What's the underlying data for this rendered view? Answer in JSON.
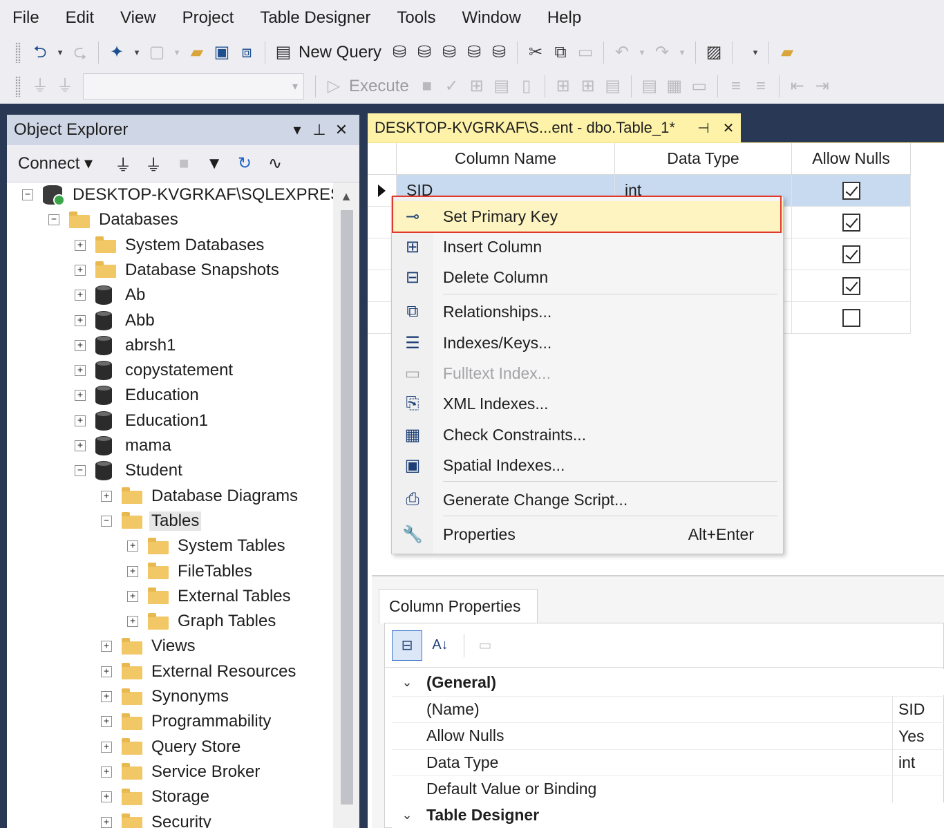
{
  "menu": [
    "File",
    "Edit",
    "View",
    "Project",
    "Table Designer",
    "Tools",
    "Window",
    "Help"
  ],
  "toolbar": {
    "new_query_label": "New Query",
    "execute_label": "Execute",
    "mdx": "MDX",
    "dmx": "DMX",
    "xmla": "XMLA",
    "dax": "DAX"
  },
  "object_explorer": {
    "title": "Object Explorer",
    "connect_label": "Connect",
    "server": "DESKTOP-KVGRKAF\\SQLEXPRESS (S",
    "tree": [
      {
        "label": "DESKTOP-KVGRKAF\\SQLEXPRESS (S",
        "toggle": "−",
        "icon": "server"
      },
      {
        "label": "Databases",
        "toggle": "−",
        "icon": "folder"
      },
      {
        "label": "System Databases",
        "toggle": "+",
        "icon": "folder"
      },
      {
        "label": "Database Snapshots",
        "toggle": "+",
        "icon": "folder"
      },
      {
        "label": "Ab",
        "toggle": "+",
        "icon": "db"
      },
      {
        "label": "Abb",
        "toggle": "+",
        "icon": "db"
      },
      {
        "label": "abrsh1",
        "toggle": "+",
        "icon": "db"
      },
      {
        "label": "copystatement",
        "toggle": "+",
        "icon": "db"
      },
      {
        "label": "Education",
        "toggle": "+",
        "icon": "db"
      },
      {
        "label": "Education1",
        "toggle": "+",
        "icon": "db"
      },
      {
        "label": "mama",
        "toggle": "+",
        "icon": "db"
      },
      {
        "label": "Student",
        "toggle": "−",
        "icon": "db"
      },
      {
        "label": "Database Diagrams",
        "toggle": "+",
        "icon": "folder"
      },
      {
        "label": "Tables",
        "toggle": "−",
        "icon": "folder"
      },
      {
        "label": "System Tables",
        "toggle": "+",
        "icon": "folder"
      },
      {
        "label": "FileTables",
        "toggle": "+",
        "icon": "folder"
      },
      {
        "label": "External Tables",
        "toggle": "+",
        "icon": "folder"
      },
      {
        "label": "Graph Tables",
        "toggle": "+",
        "icon": "folder"
      },
      {
        "label": "Views",
        "toggle": "+",
        "icon": "folder"
      },
      {
        "label": "External Resources",
        "toggle": "+",
        "icon": "folder"
      },
      {
        "label": "Synonyms",
        "toggle": "+",
        "icon": "folder"
      },
      {
        "label": "Programmability",
        "toggle": "+",
        "icon": "folder"
      },
      {
        "label": "Query Store",
        "toggle": "+",
        "icon": "folder"
      },
      {
        "label": "Service Broker",
        "toggle": "+",
        "icon": "folder"
      },
      {
        "label": "Storage",
        "toggle": "+",
        "icon": "folder"
      },
      {
        "label": "Security",
        "toggle": "+",
        "icon": "folder"
      }
    ]
  },
  "document_tab": {
    "title": "DESKTOP-KVGRKAF\\S...ent - dbo.Table_1*"
  },
  "grid": {
    "headers": [
      "Column Name",
      "Data Type",
      "Allow Nulls"
    ],
    "rows": [
      {
        "name": "SID",
        "type": "int",
        "allow_nulls": true
      },
      {
        "name": "",
        "type": "",
        "allow_nulls": true
      },
      {
        "name": "",
        "type": "",
        "allow_nulls": true
      },
      {
        "name": "",
        "type": "",
        "allow_nulls": true
      },
      {
        "name": "",
        "type": "",
        "allow_nulls": false
      }
    ]
  },
  "context_menu": {
    "items": [
      {
        "label": "Set Primary Key",
        "icon": "key-icon",
        "glyph": "⊸",
        "highlighted": true
      },
      {
        "label": "Insert Column",
        "icon": "insert-column-icon",
        "glyph": "⊞"
      },
      {
        "label": "Delete Column",
        "icon": "delete-column-icon",
        "glyph": "⊟"
      },
      {
        "label": "Relationships...",
        "icon": "relationships-icon",
        "glyph": "⧉"
      },
      {
        "label": "Indexes/Keys...",
        "icon": "indexes-icon",
        "glyph": "☰"
      },
      {
        "label": "Fulltext Index...",
        "icon": "fulltext-icon",
        "glyph": "▭",
        "disabled": true
      },
      {
        "label": "XML Indexes...",
        "icon": "xml-index-icon",
        "glyph": "⎘"
      },
      {
        "label": "Check Constraints...",
        "icon": "check-constraints-icon",
        "glyph": "▦"
      },
      {
        "label": "Spatial Indexes...",
        "icon": "spatial-index-icon",
        "glyph": "▣"
      },
      {
        "label": "Generate Change Script...",
        "icon": "change-script-icon",
        "glyph": "⎙"
      },
      {
        "label": "Properties",
        "icon": "wrench-icon",
        "glyph": "🔧",
        "shortcut": "Alt+Enter"
      }
    ]
  },
  "column_properties": {
    "tab_label": "Column Properties",
    "rows": [
      {
        "type": "category",
        "name": "(General)"
      },
      {
        "type": "item",
        "name": "(Name)",
        "value": "SID"
      },
      {
        "type": "item",
        "name": "Allow Nulls",
        "value": "Yes"
      },
      {
        "type": "item",
        "name": "Data Type",
        "value": "int"
      },
      {
        "type": "item",
        "name": "Default Value or Binding",
        "value": ""
      },
      {
        "type": "category",
        "name": "Table Designer"
      }
    ]
  },
  "colors": {
    "accent_dark": "#293955",
    "highlight": "#fdf4c2",
    "selection": "#c8daf0",
    "red_outline": "#e0392b"
  }
}
